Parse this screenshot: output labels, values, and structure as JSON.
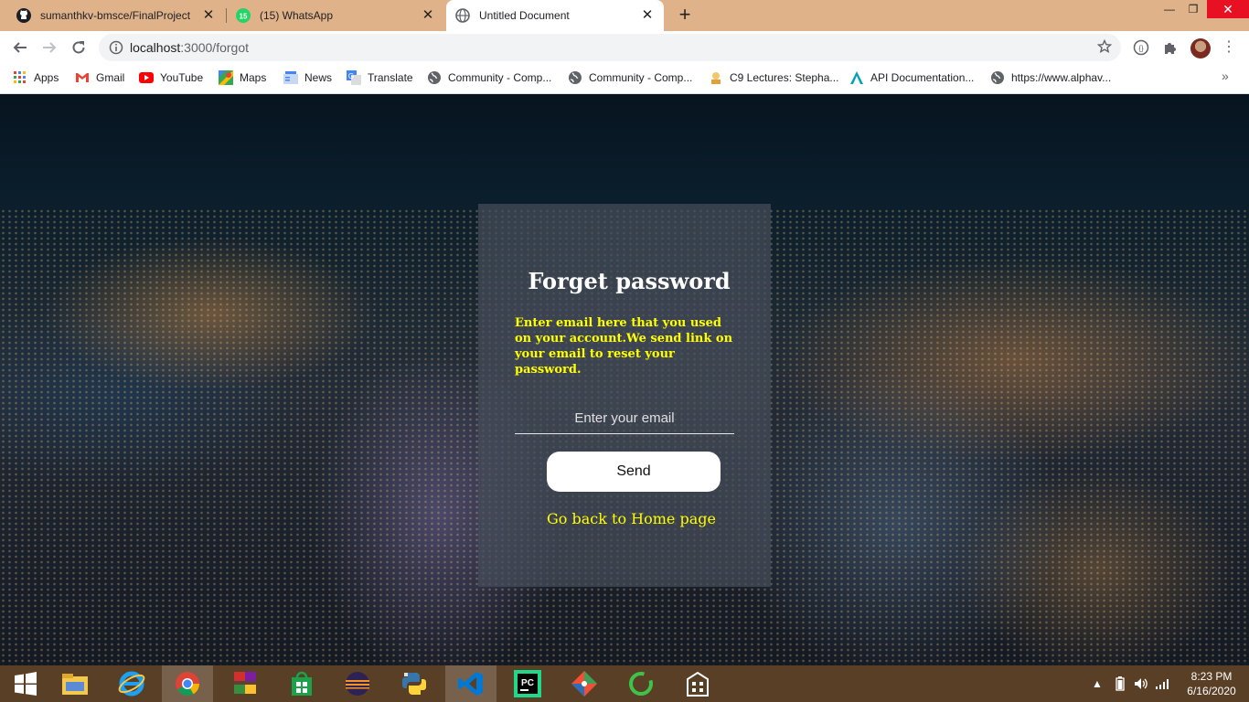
{
  "tabs": [
    {
      "title": "sumanthkv-bmsce/FinalProject",
      "icon": "github-icon"
    },
    {
      "title": "(15) WhatsApp",
      "icon": "whatsapp-icon",
      "badge": "15"
    },
    {
      "title": "Untitled Document",
      "icon": "globe-icon",
      "active": true
    }
  ],
  "toolbar": {
    "url_host": "localhost",
    "url_path": ":3000/forgot"
  },
  "bookmarks": [
    {
      "label": "Apps",
      "icon": "apps-grid-icon"
    },
    {
      "label": "Gmail",
      "icon": "gmail-icon"
    },
    {
      "label": "YouTube",
      "icon": "youtube-icon"
    },
    {
      "label": "Maps",
      "icon": "maps-icon"
    },
    {
      "label": "News",
      "icon": "news-icon"
    },
    {
      "label": "Translate",
      "icon": "translate-icon"
    },
    {
      "label": "Community - Comp...",
      "icon": "globe-icon"
    },
    {
      "label": "Community - Comp...",
      "icon": "globe-icon"
    },
    {
      "label": "C9 Lectures: Stepha...",
      "icon": "c9-icon"
    },
    {
      "label": "API Documentation...",
      "icon": "api-icon"
    },
    {
      "label": "https://www.alphav...",
      "icon": "globe-icon"
    }
  ],
  "page": {
    "title": "Forget password",
    "description": "Enter email here that you used on your account.We send link on your email to reset your password.",
    "email_placeholder": "Enter your email",
    "send_label": "Send",
    "home_link": "Go back to Home page"
  },
  "taskbar": {
    "time": "8:23 PM",
    "date": "6/16/2020"
  },
  "colors": {
    "tabstrip": "#dfb28a",
    "accent_text": "#ffff00",
    "taskbar": "#5a3f27"
  }
}
